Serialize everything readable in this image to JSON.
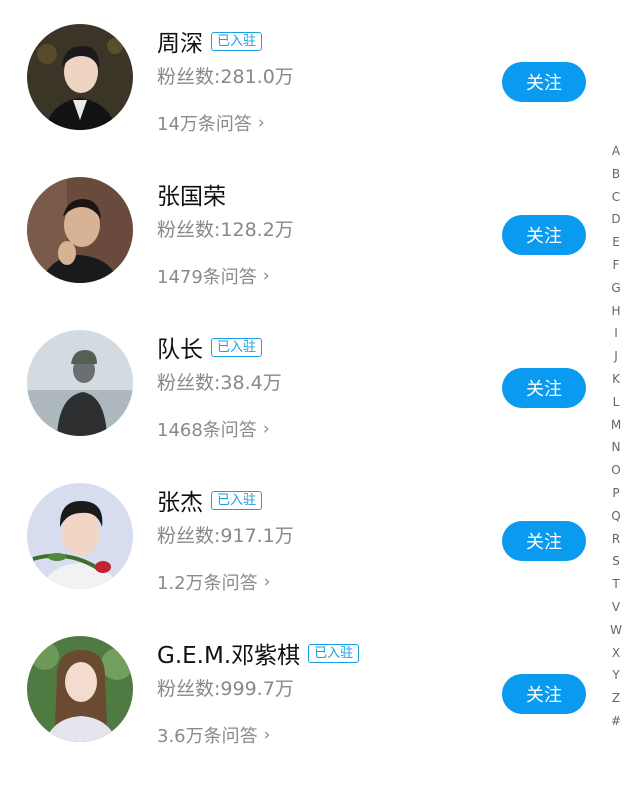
{
  "users": [
    {
      "name": "周深",
      "badge": "已入驻",
      "fans": "粉丝数:281.0万",
      "qa": "14万条问答",
      "follow": "关注",
      "avatar_bg": "#2c2a22"
    },
    {
      "name": "张国荣",
      "badge": "",
      "fans": "粉丝数:128.2万",
      "qa": "1479条问答",
      "follow": "关注",
      "avatar_bg": "#5a3d33"
    },
    {
      "name": "队长",
      "badge": "已入驻",
      "fans": "粉丝数:38.4万",
      "qa": "1468条问答",
      "follow": "关注",
      "avatar_bg": "#c9d1d6"
    },
    {
      "name": "张杰",
      "badge": "已入驻",
      "fans": "粉丝数:917.1万",
      "qa": "1.2万条问答",
      "follow": "关注",
      "avatar_bg": "#cfd4e8"
    },
    {
      "name": "G.E.M.邓紫棋",
      "badge": "已入驻",
      "fans": "粉丝数:999.7万",
      "qa": "3.6万条问答",
      "follow": "关注",
      "avatar_bg": "#5f8a4e"
    }
  ],
  "chevron": "›",
  "alphabet_index": [
    "A",
    "B",
    "C",
    "D",
    "E",
    "F",
    "G",
    "H",
    "I",
    "J",
    "K",
    "L",
    "M",
    "N",
    "O",
    "P",
    "Q",
    "R",
    "S",
    "T",
    "V",
    "W",
    "X",
    "Y",
    "Z",
    "#"
  ],
  "colors": {
    "accent": "#0a9af0",
    "badge": "#1a9ee6"
  }
}
